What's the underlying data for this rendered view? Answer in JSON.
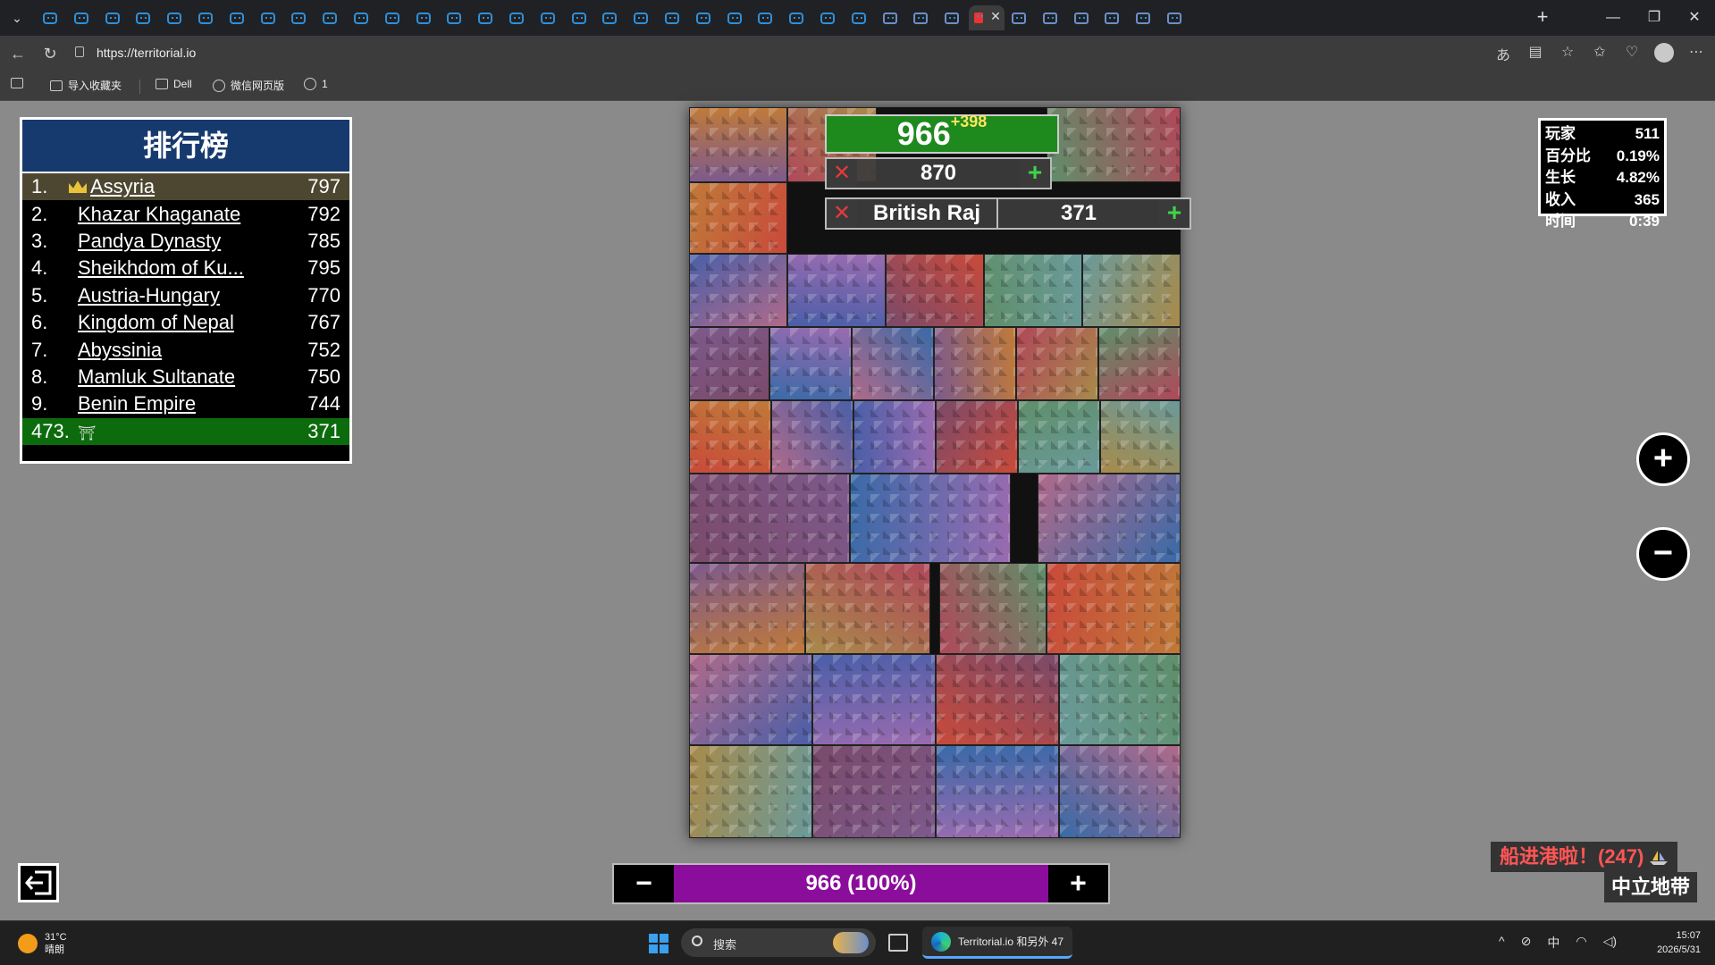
{
  "browser": {
    "url": "https://territorial.io",
    "bookmarks": [
      "导入收藏夹",
      "Dell",
      "微信网页版",
      "1"
    ],
    "tab_count_favicons": 36
  },
  "leaderboard": {
    "title": "排行榜",
    "rows": [
      {
        "rank": "1.",
        "name": "Assyria",
        "score": "797"
      },
      {
        "rank": "2.",
        "name": "Khazar Khaganate",
        "score": "792"
      },
      {
        "rank": "3.",
        "name": "Pandya Dynasty",
        "score": "785"
      },
      {
        "rank": "4.",
        "name": "Sheikhdom of Ku...",
        "score": "795"
      },
      {
        "rank": "5.",
        "name": "Austria-Hungary",
        "score": "770"
      },
      {
        "rank": "6.",
        "name": "Kingdom of Nepal",
        "score": "767"
      },
      {
        "rank": "7.",
        "name": "Abyssinia",
        "score": "752"
      },
      {
        "rank": "8.",
        "name": "Mamluk Sultanate",
        "score": "750"
      },
      {
        "rank": "9.",
        "name": "Benin Empire",
        "score": "744"
      }
    ],
    "mine": {
      "rank": "473.",
      "score": "371"
    }
  },
  "hud": {
    "balance": "966",
    "balance_delta": "+398",
    "target_value": "870",
    "opponent_name": "British Raj",
    "opponent_value": "371"
  },
  "stats": {
    "rows": [
      {
        "label": "玩家",
        "value": "511"
      },
      {
        "label": "百分比",
        "value": "0.19%"
      },
      {
        "label": "生长",
        "value": "4.82%"
      },
      {
        "label": "收入",
        "value": "365"
      },
      {
        "label": "时间",
        "value": "0:39"
      }
    ]
  },
  "zoom": {
    "in_label": "+",
    "out_label": "−"
  },
  "troops": {
    "minus": "−",
    "value": "966 (100%)",
    "plus": "+",
    "fill_fraction": 1.0
  },
  "notice": {
    "text": "船进港啦！(247)",
    "zone": "中立地带"
  },
  "taskbar": {
    "temp": "31°C",
    "weather": "晴朗",
    "search": "搜索",
    "active_app": "Territorial.io 和另外 47",
    "ime": "中",
    "time": "15:07",
    "date": "2026/5/31"
  },
  "colors": {
    "leaderboard_header": "#173a6e",
    "player_green": "#0c6b0c",
    "troop_purple": "#8b0d9b",
    "notice_red": "#ff5555"
  }
}
